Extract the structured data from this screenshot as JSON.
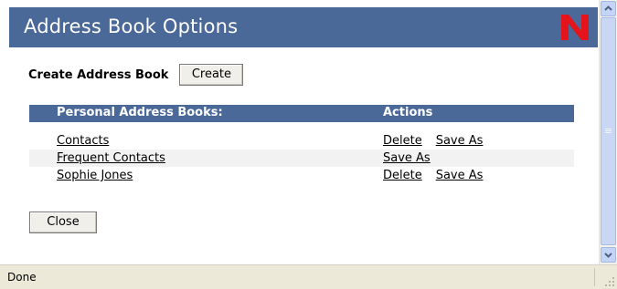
{
  "window": {
    "title": "Address Book Options",
    "logo_letter": "N"
  },
  "colors": {
    "header_blue": "#4a6898",
    "logo_red": "#e3141b"
  },
  "create_section": {
    "label": "Create Address Book",
    "button_label": "Create"
  },
  "table": {
    "headers": {
      "name": "Personal Address Books:",
      "actions": "Actions"
    },
    "rows": [
      {
        "name": "Contacts",
        "delete_label": "Delete",
        "save_as_label": "Save As"
      },
      {
        "name": "Frequent Contacts",
        "save_as_label": "Save As"
      },
      {
        "name": "Sophie Jones",
        "delete_label": "Delete",
        "save_as_label": "Save As"
      }
    ]
  },
  "close_button": {
    "label": "Close"
  },
  "status_bar": {
    "text": "Done"
  },
  "icons": {
    "scroll_up": "chevron-up-icon",
    "scroll_down": "chevron-down-icon",
    "logo": "novell-n-logo"
  }
}
